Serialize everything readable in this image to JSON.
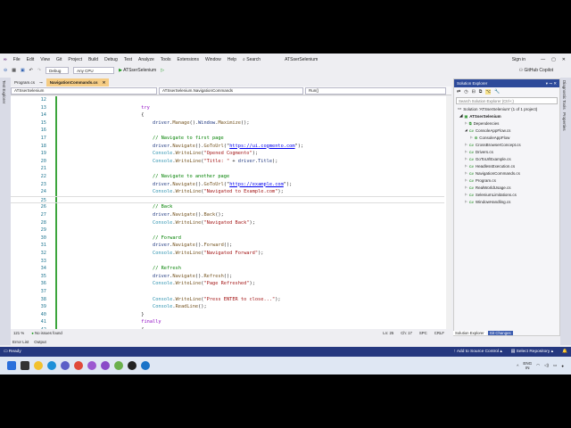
{
  "title": "ATSserSelenium",
  "menu": [
    "File",
    "Edit",
    "View",
    "Git",
    "Project",
    "Build",
    "Debug",
    "Test",
    "Analyze",
    "Tools",
    "Extensions",
    "Window",
    "Help"
  ],
  "search_label": "Search",
  "sign_in": "Sign in",
  "copilot": "GitHub Copilot",
  "toolbar": {
    "config": "Debug",
    "platform": "Any CPU",
    "run_target": "ATSserSelenium"
  },
  "left_strip": "Test Explorer",
  "right_strip": [
    "Diagnostic Tools",
    "Properties"
  ],
  "tabs": [
    {
      "label": "Program.cs"
    },
    {
      "label": "NavigationCommands.cs"
    }
  ],
  "navbar": {
    "project": "ATSserSelenium",
    "class": "ATSserSelenium.NavigationCommands",
    "member": "Run()"
  },
  "code_lines": [
    {
      "n": "12",
      "t": []
    },
    {
      "n": "13",
      "t": [
        [
          "kw",
          "            try"
        ]
      ]
    },
    {
      "n": "14",
      "t": [
        [
          "",
          "            {"
        ]
      ]
    },
    {
      "n": "15",
      "t": [
        [
          "id",
          "                driver"
        ],
        [
          "",
          "."
        ],
        [
          "mth",
          "Manage"
        ],
        [
          "",
          "()."
        ],
        [
          "id",
          "Window"
        ],
        [
          "",
          "."
        ],
        [
          "mth",
          "Maximize"
        ],
        [
          "",
          "();"
        ]
      ]
    },
    {
      "n": "16",
      "t": []
    },
    {
      "n": "17",
      "t": [
        [
          "cm",
          "                // Navigate to first page"
        ]
      ]
    },
    {
      "n": "18",
      "t": [
        [
          "id",
          "                driver"
        ],
        [
          "",
          "."
        ],
        [
          "mth",
          "Navigate"
        ],
        [
          "",
          "()."
        ],
        [
          "mth",
          "GoToUrl"
        ],
        [
          "",
          "(\""
        ],
        [
          "url",
          "https://ui.cogmento.com"
        ],
        [
          "",
          "\");"
        ]
      ]
    },
    {
      "n": "19",
      "t": [
        [
          "cls",
          "                Console"
        ],
        [
          "",
          "."
        ],
        [
          "mth",
          "WriteLine"
        ],
        [
          "",
          "("
        ],
        [
          "str",
          "\"Opened Cogmento\""
        ],
        [
          "",
          ");"
        ]
      ]
    },
    {
      "n": "20",
      "t": [
        [
          "cls",
          "                Console"
        ],
        [
          "",
          "."
        ],
        [
          "mth",
          "WriteLine"
        ],
        [
          "",
          "("
        ],
        [
          "str",
          "\"Title: \""
        ],
        [
          "",
          " + "
        ],
        [
          "id",
          "driver"
        ],
        [
          "",
          "."
        ],
        [
          "id",
          "Title"
        ],
        [
          "",
          ");"
        ]
      ]
    },
    {
      "n": "21",
      "t": []
    },
    {
      "n": "22",
      "t": [
        [
          "cm",
          "                // Navigate to another page"
        ]
      ]
    },
    {
      "n": "23",
      "t": [
        [
          "id",
          "                driver"
        ],
        [
          "",
          "."
        ],
        [
          "mth",
          "Navigate"
        ],
        [
          "",
          "()."
        ],
        [
          "mth",
          "GoToUrl"
        ],
        [
          "",
          "(\""
        ],
        [
          "url",
          "https://example.com"
        ],
        [
          "",
          "\");"
        ]
      ]
    },
    {
      "n": "24",
      "t": [
        [
          "cls",
          "                Console"
        ],
        [
          "",
          "."
        ],
        [
          "mth",
          "WriteLine"
        ],
        [
          "",
          "("
        ],
        [
          "str",
          "\"Navigated to Example.com\""
        ],
        [
          "",
          ");"
        ]
      ]
    },
    {
      "n": "25",
      "t": []
    },
    {
      "n": "26",
      "t": [
        [
          "cm",
          "                // Back"
        ]
      ]
    },
    {
      "n": "27",
      "t": [
        [
          "id",
          "                driver"
        ],
        [
          "",
          "."
        ],
        [
          "mth",
          "Navigate"
        ],
        [
          "",
          "()."
        ],
        [
          "mth",
          "Back"
        ],
        [
          "",
          "();"
        ]
      ]
    },
    {
      "n": "28",
      "t": [
        [
          "cls",
          "                Console"
        ],
        [
          "",
          "."
        ],
        [
          "mth",
          "WriteLine"
        ],
        [
          "",
          "("
        ],
        [
          "str",
          "\"Navigated Back\""
        ],
        [
          "",
          ");"
        ]
      ]
    },
    {
      "n": "29",
      "t": []
    },
    {
      "n": "30",
      "t": [
        [
          "cm",
          "                // Forward"
        ]
      ]
    },
    {
      "n": "31",
      "t": [
        [
          "id",
          "                driver"
        ],
        [
          "",
          "."
        ],
        [
          "mth",
          "Navigate"
        ],
        [
          "",
          "()."
        ],
        [
          "mth",
          "Forward"
        ],
        [
          "",
          "();"
        ]
      ]
    },
    {
      "n": "32",
      "t": [
        [
          "cls",
          "                Console"
        ],
        [
          "",
          "."
        ],
        [
          "mth",
          "WriteLine"
        ],
        [
          "",
          "("
        ],
        [
          "str",
          "\"Navigated Forward\""
        ],
        [
          "",
          ");"
        ]
      ]
    },
    {
      "n": "33",
      "t": []
    },
    {
      "n": "34",
      "t": [
        [
          "cm",
          "                // Refresh"
        ]
      ]
    },
    {
      "n": "35",
      "t": [
        [
          "id",
          "                driver"
        ],
        [
          "",
          "."
        ],
        [
          "mth",
          "Navigate"
        ],
        [
          "",
          "()."
        ],
        [
          "mth",
          "Refresh"
        ],
        [
          "",
          "();"
        ]
      ]
    },
    {
      "n": "36",
      "t": [
        [
          "cls",
          "                Console"
        ],
        [
          "",
          "."
        ],
        [
          "mth",
          "WriteLine"
        ],
        [
          "",
          "("
        ],
        [
          "str",
          "\"Page Refreshed\""
        ],
        [
          "",
          ");"
        ]
      ]
    },
    {
      "n": "37",
      "t": []
    },
    {
      "n": "38",
      "t": [
        [
          "cls",
          "                Console"
        ],
        [
          "",
          "."
        ],
        [
          "mth",
          "WriteLine"
        ],
        [
          "",
          "("
        ],
        [
          "str",
          "\"Press ENTER to close...\""
        ],
        [
          "",
          ");"
        ]
      ]
    },
    {
      "n": "39",
      "t": [
        [
          "cls",
          "                Console"
        ],
        [
          "",
          "."
        ],
        [
          "mth",
          "ReadLine"
        ],
        [
          "",
          "();"
        ]
      ]
    },
    {
      "n": "40",
      "t": [
        [
          "",
          "            }"
        ]
      ]
    },
    {
      "n": "41",
      "t": [
        [
          "kw",
          "            finally"
        ]
      ]
    },
    {
      "n": "42",
      "t": [
        [
          "",
          "            {"
        ]
      ]
    }
  ],
  "editor_status": {
    "zoom": "121 %",
    "issues": "No issues found",
    "ln": "Ln: 25",
    "ch": "Ch: 17",
    "spc": "SPC",
    "crlf": "CRLF"
  },
  "bottom_tabs": [
    "Error List",
    "Output"
  ],
  "status": {
    "ready": "Ready",
    "source_control": "Add to Source Control",
    "repo": "Select Repository"
  },
  "solution_explorer": {
    "title": "Solution Explorer",
    "search_placeholder": "Search Solution Explorer (Ctrl+;)",
    "solution": "Solution 'ATSserSelenium' (1 of 1 project)",
    "project": "ATSserSelenium",
    "items": [
      {
        "label": "Dependencies",
        "indent": 2,
        "kind": "dep"
      },
      {
        "label": "ConsoleAppFlow.cs",
        "indent": 2,
        "kind": "cs"
      },
      {
        "label": "ConsoleAppFlow",
        "indent": 3,
        "kind": "class"
      },
      {
        "label": "CrossBrowserConcept.cs",
        "indent": 2,
        "kind": "cs"
      },
      {
        "label": "Drivers.cs",
        "indent": 2,
        "kind": "cs"
      },
      {
        "label": "GoToUrlExample.cs",
        "indent": 2,
        "kind": "cs"
      },
      {
        "label": "HeadlessExecution.cs",
        "indent": 2,
        "kind": "cs"
      },
      {
        "label": "NavigationCommands.cs",
        "indent": 2,
        "kind": "cs"
      },
      {
        "label": "Program.cs",
        "indent": 2,
        "kind": "cs"
      },
      {
        "label": "RealWorldUsage.cs",
        "indent": 2,
        "kind": "cs"
      },
      {
        "label": "SeleniumLimitations.cs",
        "indent": 2,
        "kind": "cs"
      },
      {
        "label": "WindowHandling.cs",
        "indent": 2,
        "kind": "cs"
      }
    ],
    "tabs": [
      "Solution Explorer",
      "Git Changes"
    ]
  },
  "tray": {
    "lang": "ENG",
    "region": "IN"
  },
  "taskbar_apps": [
    "start",
    "search",
    "file-explorer",
    "edge",
    "teams",
    "chrome",
    "copilot",
    "visual-studio",
    "notepad",
    "app",
    "outlook"
  ]
}
